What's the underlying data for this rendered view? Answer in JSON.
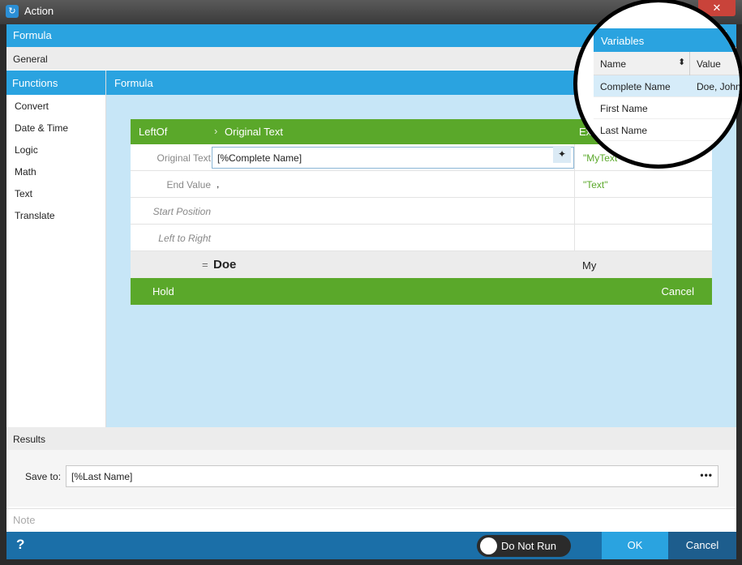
{
  "window": {
    "title": "Action",
    "close_glyph": "✕"
  },
  "formula_bar": {
    "label": "Formula"
  },
  "general": {
    "label": "General"
  },
  "functions": {
    "header": "Functions",
    "items": [
      "Convert",
      "Date & Time",
      "Logic",
      "Math",
      "Text",
      "Translate"
    ]
  },
  "formula_panel": {
    "header": "Formula"
  },
  "card": {
    "function_name": "LeftOf",
    "current_argument": "Original Text",
    "example_header": "Ex",
    "rows": [
      {
        "label": "Original Text",
        "value": "[%Complete Name]",
        "example": "\"MyText\""
      },
      {
        "label": "End Value",
        "value": ",",
        "example": "\"Text\""
      },
      {
        "label": "Start Position",
        "value": "",
        "example": ""
      },
      {
        "label": "Left to Right",
        "value": "",
        "example": ""
      }
    ],
    "result": {
      "equals": "=",
      "value": "Doe",
      "example_value": "My"
    },
    "hold_label": "Hold",
    "cancel_label": "Cancel"
  },
  "results": {
    "label": "Results"
  },
  "save_to": {
    "label": "Save to:",
    "value": "[%Last Name]",
    "browse": "•••"
  },
  "note": {
    "placeholder": "Note"
  },
  "footer": {
    "help": "?",
    "toggle_label": "Do Not Run",
    "ok": "OK",
    "cancel": "Cancel"
  },
  "variables": {
    "header": "Variables",
    "columns": [
      "Name",
      "Value"
    ],
    "rows": [
      {
        "name": "Complete Name",
        "value": "Doe, John",
        "selected": true
      },
      {
        "name": "First Name",
        "value": ""
      },
      {
        "name": "Last Name",
        "value": ""
      }
    ]
  },
  "colors": {
    "accent": "#2aa3e0",
    "green": "#5aa82a",
    "footer": "#1b6fa8"
  }
}
